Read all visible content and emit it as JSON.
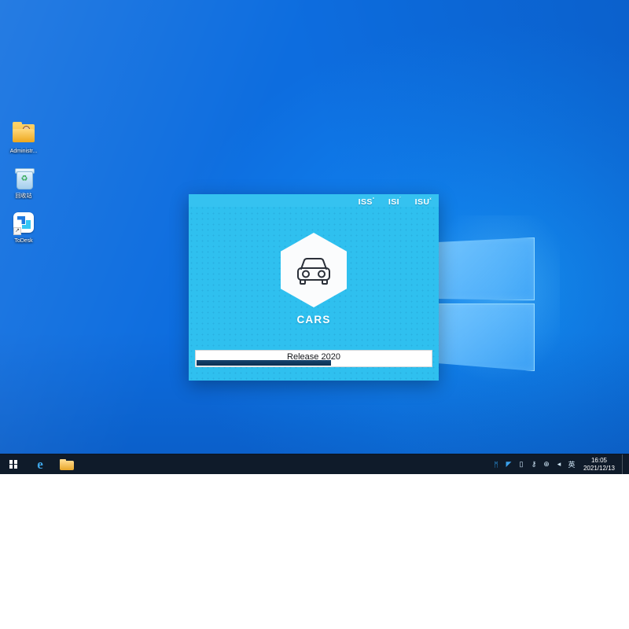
{
  "desktop": {
    "wallpaper_name": "windows-10-hero-blue",
    "icons": [
      {
        "name": "administrator-folder",
        "label": "Administr...",
        "icon": "user-folder-icon"
      },
      {
        "name": "recycle-bin",
        "label": "回收站",
        "icon": "recycle-bin-icon"
      },
      {
        "name": "todesk",
        "label": "ToDesk",
        "icon": "todesk-icon"
      }
    ]
  },
  "splash": {
    "brand": {
      "item1": "ISS",
      "item1_sup": "°",
      "item2": "ISI",
      "item2_sup": "´",
      "item3": "ISU",
      "item3_sup": "ˣ"
    },
    "logo_icon": "car-front-hexagon-icon",
    "title": "CARS",
    "progress": {
      "text": "Release 2020",
      "percent": 57
    },
    "colors": {
      "background": "#2fc0ef",
      "band": "#35c2f0",
      "bar_fill": "#16436f",
      "bar_track": "#ffffff"
    }
  },
  "taskbar": {
    "start_button_label": "Start",
    "pinned": [
      {
        "name": "internet-explorer",
        "label": "Internet Explorer",
        "icon": "ie-icon"
      },
      {
        "name": "file-explorer",
        "label": "File Explorer",
        "icon": "folder-icon"
      }
    ],
    "tray": [
      {
        "name": "bluetooth",
        "glyph": "ᛗ",
        "color": "#2f9ff0"
      },
      {
        "name": "todesk-tray",
        "glyph": "◤",
        "color": "#3aa0ea"
      },
      {
        "name": "battery",
        "glyph": "▯",
        "color": "#d6e7f4"
      },
      {
        "name": "usb-safely-remove",
        "glyph": "⚷",
        "color": "#d6e7f4"
      },
      {
        "name": "network",
        "glyph": "⊕",
        "color": "#d6e7f4"
      },
      {
        "name": "volume",
        "glyph": "◂",
        "color": "#d6e7f4"
      },
      {
        "name": "ime-language",
        "glyph": "英",
        "color": "#d6e7f4"
      }
    ],
    "clock": {
      "time": "16:05",
      "date": "2021/12/13"
    }
  }
}
